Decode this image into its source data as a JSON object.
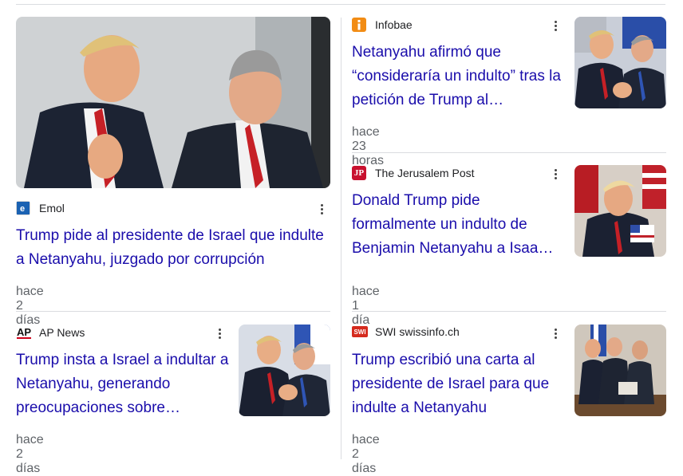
{
  "cards": [
    {
      "source": "Emol",
      "title": "Trump pide al presidente de Israel que indulte a Netanyahu, juzgado por corrupción",
      "time": "hace 2 días"
    },
    {
      "source": "AP News",
      "logo_text": "AP",
      "title": "Trump insta a Israel a indultar a Netanyahu, generando preocupaciones sobre…",
      "time": "hace 2 días"
    },
    {
      "source": "Infobae",
      "title": "Netanyahu afirmó que “consideraría un indulto” tras la petición de Trump al…",
      "time": "hace 23 horas"
    },
    {
      "source": "The Jerusalem Post",
      "logo_text": "JP",
      "title": "Donald Trump pide formalmente un indulto de Benjamin Netanyahu a Isaa…",
      "time": "hace 1 día"
    },
    {
      "source": "SWI swissinfo.ch",
      "logo_text": "SWI",
      "title": "Trump escribió una carta al presidente de Israel para que indulte a Netanyahu",
      "time": "hace 2 días"
    }
  ],
  "colors": {
    "link": "#1a0dab",
    "meta": "#5f6368",
    "divider": "#dadce0"
  },
  "icons": {
    "menu": "more-vert-icon"
  }
}
